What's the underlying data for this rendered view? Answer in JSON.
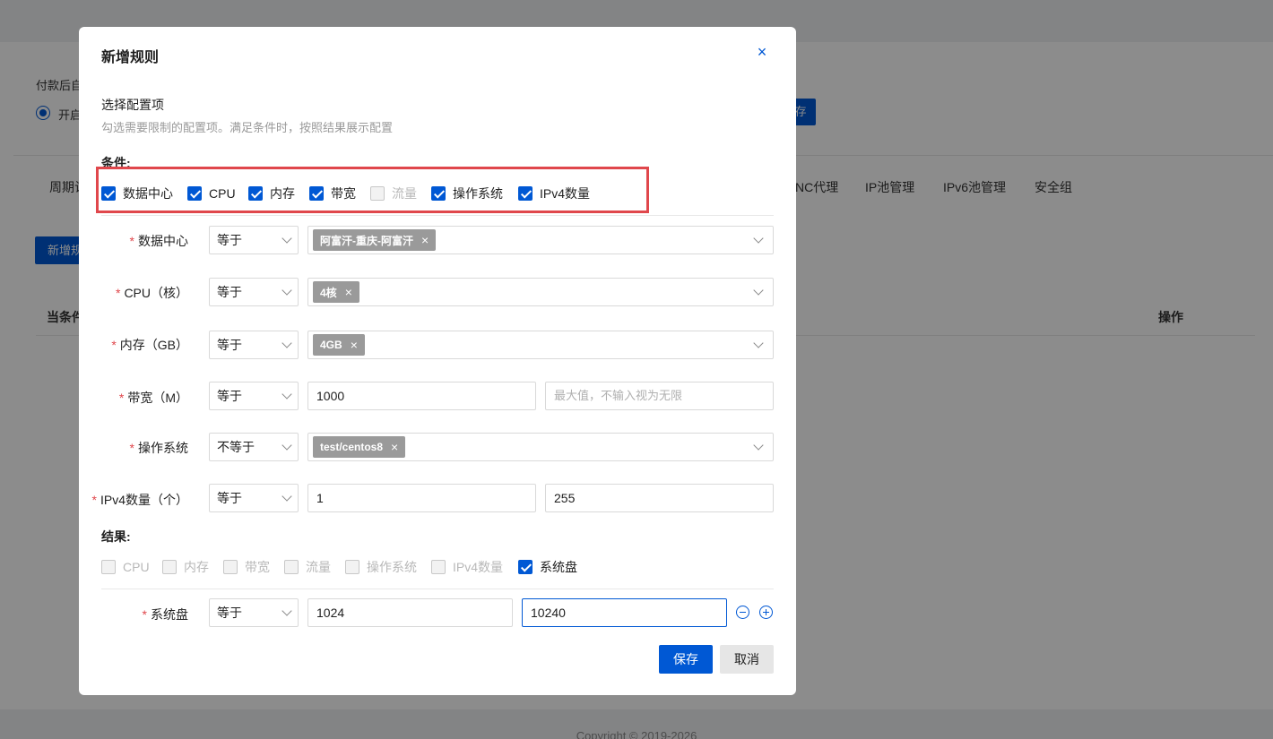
{
  "background": {
    "pay_label": "付款后自",
    "radio_label": "开启",
    "save_btn": "存",
    "tabs": [
      "周期计",
      "NC代理",
      "IP池管理",
      "IPv6池管理",
      "安全组"
    ],
    "add_btn": "新增规",
    "table_headers": [
      "当条件",
      "操作"
    ],
    "footer": "Copyright © 2019-2026"
  },
  "modal": {
    "title": "新增规则",
    "close_icon": "close-icon",
    "section_title": "选择配置项",
    "section_desc": "勾选需要限制的配置项。满足条件时，按照结果展示配置",
    "condition_label": "条件:",
    "condition_checks": [
      {
        "label": "数据中心",
        "checked": true,
        "disabled": false
      },
      {
        "label": "CPU",
        "checked": true,
        "disabled": false
      },
      {
        "label": "内存",
        "checked": true,
        "disabled": false
      },
      {
        "label": "带宽",
        "checked": true,
        "disabled": false
      },
      {
        "label": "流量",
        "checked": false,
        "disabled": true
      },
      {
        "label": "操作系统",
        "checked": true,
        "disabled": false
      },
      {
        "label": "IPv4数量",
        "checked": true,
        "disabled": false
      }
    ],
    "rows": {
      "datacenter": {
        "label": "数据中心",
        "op": "等于",
        "tag": "阿富汗-重庆-阿富汗"
      },
      "cpu": {
        "label": "CPU（核）",
        "op": "等于",
        "tag": "4核"
      },
      "memory": {
        "label": "内存（GB）",
        "op": "等于",
        "tag": "4GB"
      },
      "bandwidth": {
        "label": "带宽（M）",
        "op": "等于",
        "min": "1000",
        "max_placeholder": "最大值，不输入视为无限"
      },
      "os": {
        "label": "操作系统",
        "op": "不等于",
        "tag": "test/centos8"
      },
      "ipv4": {
        "label": "IPv4数量（个）",
        "op": "等于",
        "min": "1",
        "max": "255"
      }
    },
    "result_label": "结果:",
    "result_checks": [
      {
        "label": "CPU",
        "checked": false
      },
      {
        "label": "内存",
        "checked": false
      },
      {
        "label": "带宽",
        "checked": false
      },
      {
        "label": "流量",
        "checked": false
      },
      {
        "label": "操作系统",
        "checked": false
      },
      {
        "label": "IPv4数量",
        "checked": false
      },
      {
        "label": "系统盘",
        "checked": true
      }
    ],
    "disk": {
      "label": "系统盘",
      "op": "等于",
      "min": "1024",
      "max": "10240"
    },
    "save_label": "保存",
    "cancel_label": "取消"
  }
}
